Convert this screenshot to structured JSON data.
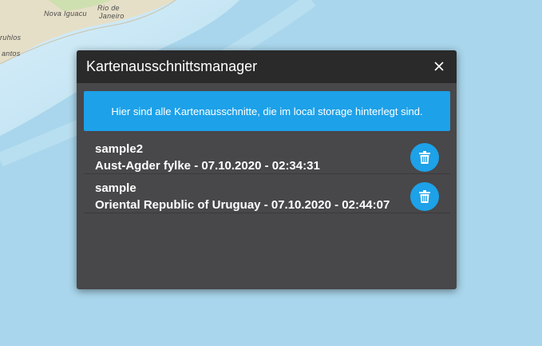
{
  "map": {
    "labels": [
      "Nova Iguacu",
      "Rio de",
      "Janeiro",
      "ruhlos",
      "antos"
    ]
  },
  "dialog": {
    "title": "Kartenausschnittsmanager",
    "close_icon": "close-icon",
    "info_text": "Hier sind alle Kartenausschnitte, die im local storage hinterlegt sind.",
    "items": [
      {
        "name": "sample2",
        "detail": "Aust-Agder fylke - 07.10.2020 - 02:34:31",
        "delete_icon": "trash-icon"
      },
      {
        "name": "sample",
        "detail": "Oriental Republic of Uruguay - 07.10.2020 - 02:44:07",
        "delete_icon": "trash-icon"
      }
    ]
  },
  "colors": {
    "accent": "#1da1e8",
    "dialog_bg": "#484749",
    "titlebar_bg": "#2a2a2b",
    "water": "#a9d6ec",
    "land": "#e4dcc6"
  }
}
